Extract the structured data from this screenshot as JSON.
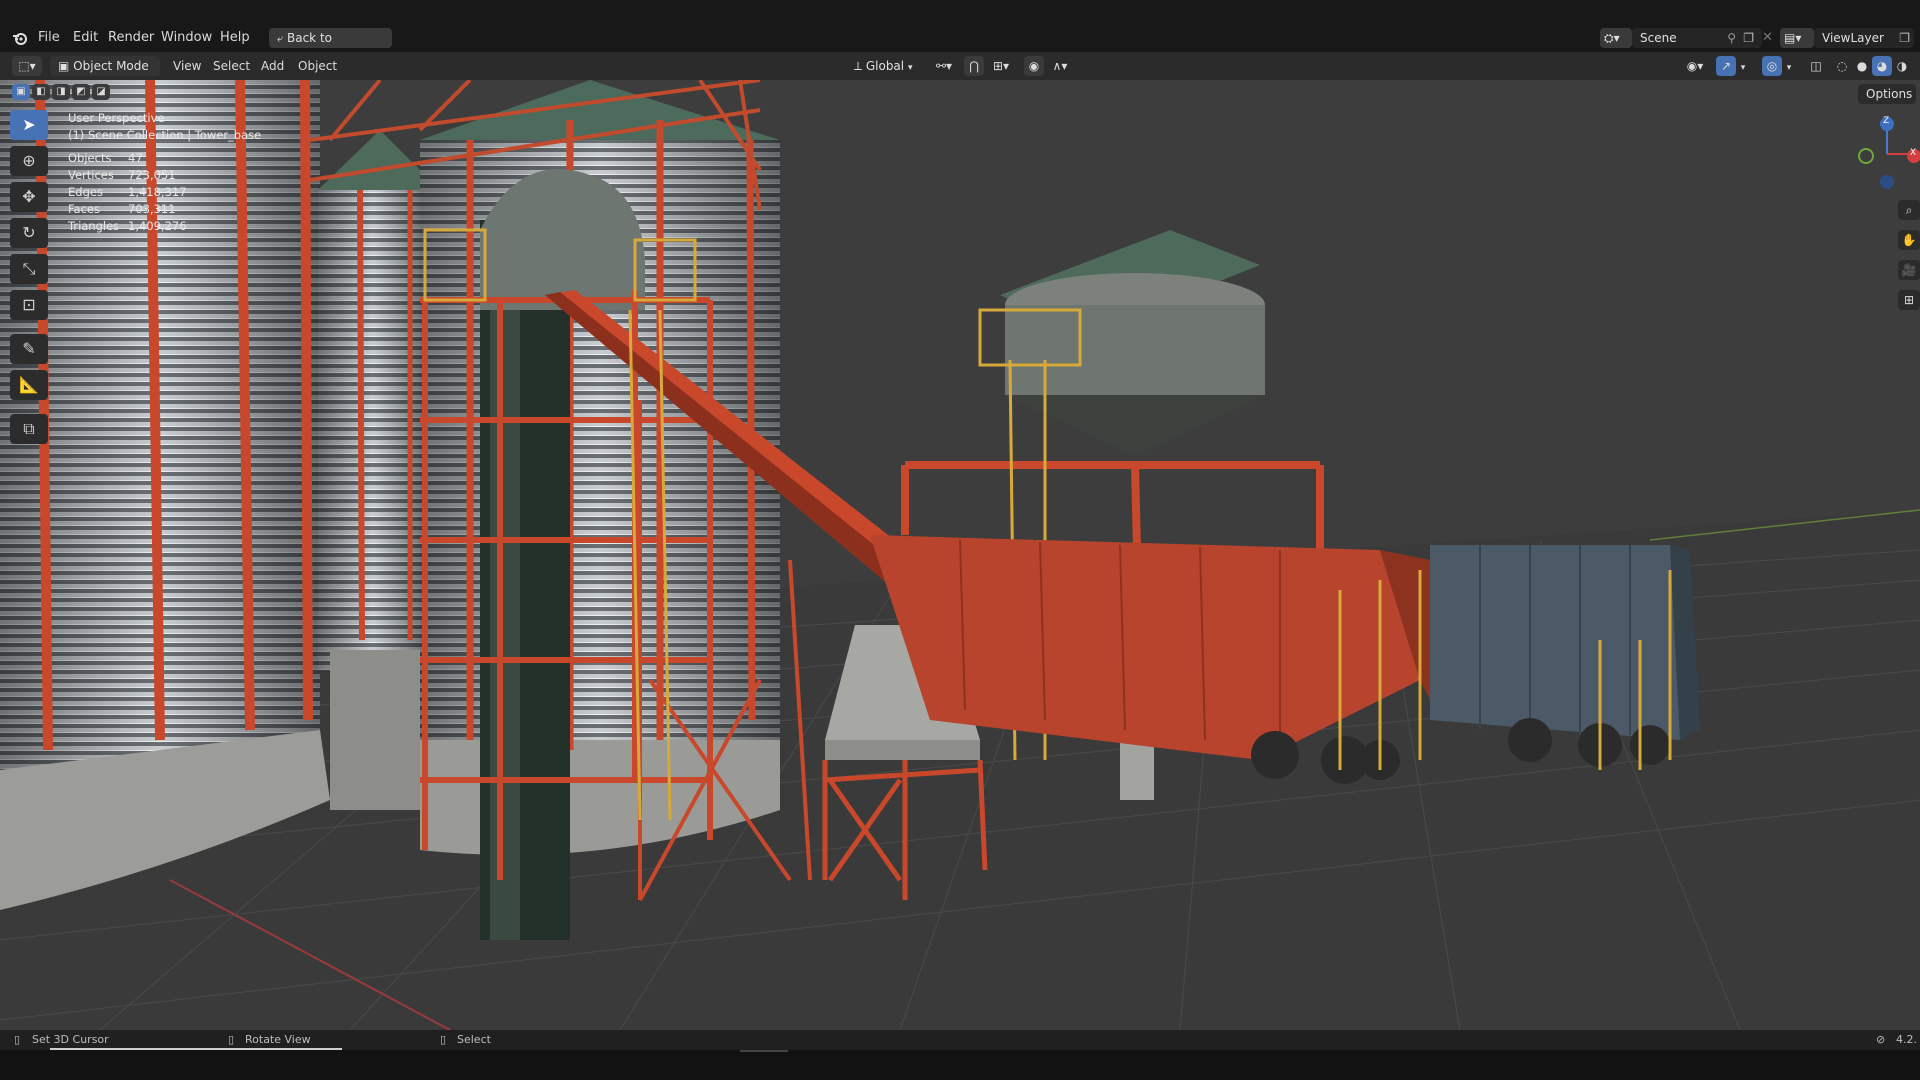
{
  "top_menu": {
    "items": [
      "File",
      "Edit",
      "Render",
      "Window",
      "Help"
    ],
    "back_button": "Back to Previous",
    "scene_label": "Scene",
    "viewlayer_label": "ViewLayer"
  },
  "viewport_header": {
    "mode": "Object Mode",
    "menus": [
      "View",
      "Select",
      "Add",
      "Object"
    ],
    "transform_orientation": "Global",
    "options_label": "Options"
  },
  "overlay": {
    "view_name": "User Perspective",
    "collection": "(1) Scene Collection | Tower_base",
    "stats": [
      {
        "label": "Objects",
        "value": "47"
      },
      {
        "label": "Vertices",
        "value": "723,051"
      },
      {
        "label": "Edges",
        "value": "1,418,317"
      },
      {
        "label": "Faces",
        "value": "703,311"
      },
      {
        "label": "Triangles",
        "value": "1,409,276"
      }
    ]
  },
  "status_bar": {
    "items": [
      "Set 3D Cursor",
      "Rotate View",
      "Select"
    ],
    "version": "4.2."
  },
  "gizmo": {
    "x": "X",
    "y": "Y",
    "z": "Z"
  },
  "colors": {
    "accent": "#4772b3",
    "structure_orange": "#c9482c",
    "hopper_car_orange": "#b8442d",
    "hopper_car_blue": "#4b5a66",
    "ladder_yellow": "#d7a93a",
    "viewport_bg": "#3d3d3d"
  }
}
